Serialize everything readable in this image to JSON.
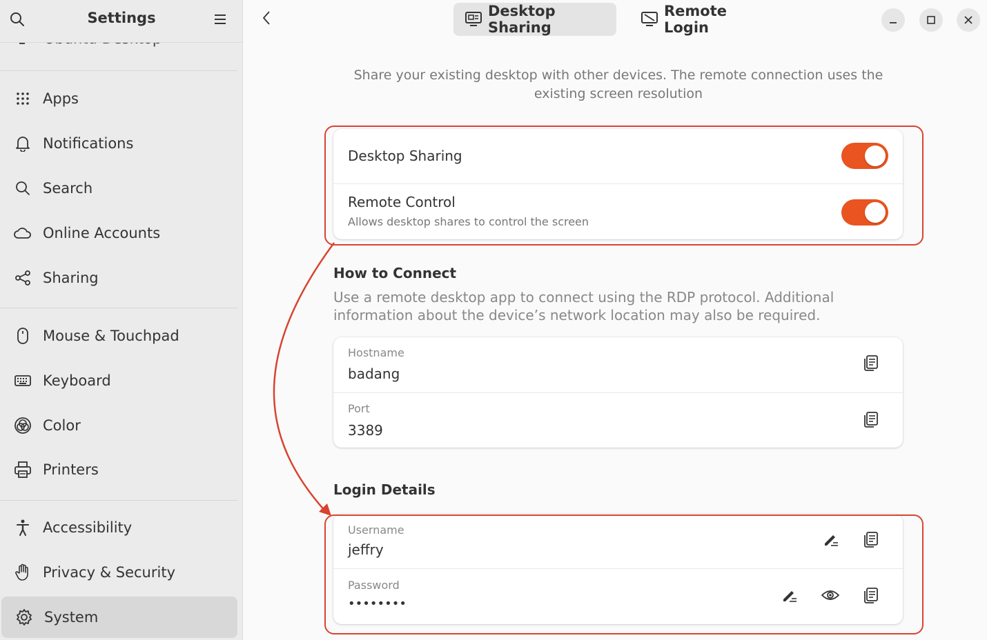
{
  "sidebar": {
    "title": "Settings",
    "cut_item_label": "Ubuntu Desktop",
    "items": [
      {
        "label": "Apps",
        "icon": "apps-grid-icon"
      },
      {
        "label": "Notifications",
        "icon": "bell-icon"
      },
      {
        "label": "Search",
        "icon": "search-icon"
      },
      {
        "label": "Online Accounts",
        "icon": "cloud-icon"
      },
      {
        "label": "Sharing",
        "icon": "share-icon"
      },
      {
        "label": "Mouse & Touchpad",
        "icon": "mouse-icon"
      },
      {
        "label": "Keyboard",
        "icon": "keyboard-icon"
      },
      {
        "label": "Color",
        "icon": "color-icon"
      },
      {
        "label": "Printers",
        "icon": "printer-icon"
      },
      {
        "label": "Accessibility",
        "icon": "accessibility-icon"
      },
      {
        "label": "Privacy & Security",
        "icon": "hand-icon"
      },
      {
        "label": "System",
        "icon": "gear-icon",
        "active": true
      }
    ]
  },
  "header": {
    "tabs": [
      {
        "label": "Desktop Sharing",
        "icon": "desktop-sharing-icon",
        "active": true
      },
      {
        "label": "Remote Login",
        "icon": "remote-login-icon",
        "active": false
      }
    ]
  },
  "main": {
    "intro": "Share your existing desktop with other devices. The remote connection uses the existing screen resolution",
    "sharing_card": {
      "desktop_sharing": {
        "title": "Desktop Sharing",
        "enabled": true
      },
      "remote_control": {
        "title": "Remote Control",
        "subtitle": "Allows desktop shares to control the screen",
        "enabled": true
      }
    },
    "how_to_connect": {
      "title": "How to Connect",
      "description": "Use a remote desktop app to connect using the RDP protocol. Additional information about the device’s network location may also be required.",
      "hostname": {
        "label": "Hostname",
        "value": "badang"
      },
      "port": {
        "label": "Port",
        "value": "3389"
      }
    },
    "login_details": {
      "title": "Login Details",
      "username": {
        "label": "Username",
        "value": "jeffry"
      },
      "password": {
        "label": "Password",
        "value": "••••••••"
      }
    }
  },
  "colors": {
    "accent": "#e95420",
    "annotation": "#d9432f"
  }
}
